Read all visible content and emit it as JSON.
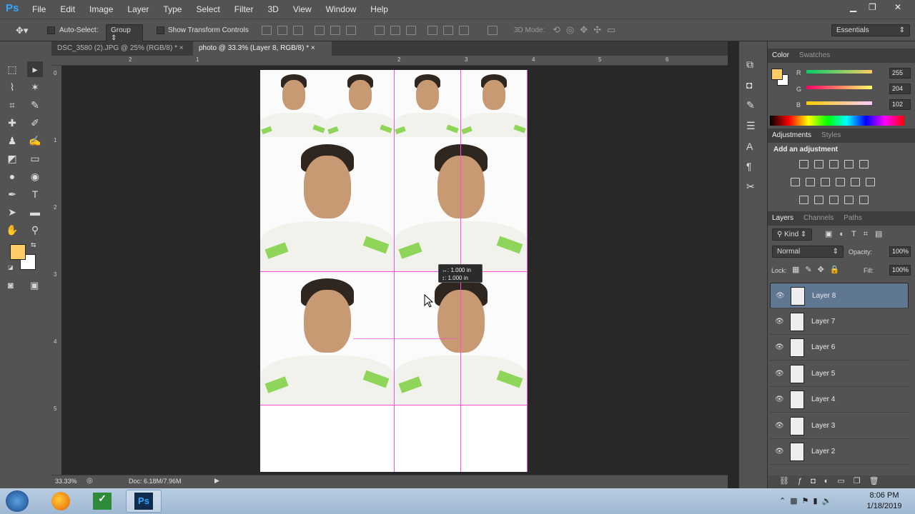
{
  "app": {
    "logo": "Ps"
  },
  "menu": [
    "File",
    "Edit",
    "Image",
    "Layer",
    "Type",
    "Select",
    "Filter",
    "3D",
    "View",
    "Window",
    "Help"
  ],
  "window_controls": {
    "minimize": "▁",
    "restore": "❐",
    "close": "✕"
  },
  "options": {
    "auto_select": "Auto-Select:",
    "auto_select_value": "Group",
    "show_transform": "Show Transform Controls",
    "mode_3d": "3D Mode:",
    "workspace": "Essentials"
  },
  "tabs": [
    {
      "label": "DSC_3580 (2).JPG @ 25% (RGB/8) *",
      "close": "×"
    },
    {
      "label": "photo @ 33.3% (Layer 8, RGB/8) *",
      "close": "×"
    }
  ],
  "ruler_h": [
    "2",
    "1",
    "2",
    "3",
    "4",
    "5",
    "6"
  ],
  "ruler_v": [
    "0",
    "1",
    "2",
    "3",
    "4",
    "5"
  ],
  "measure": {
    "w": "↔: 1.000 in",
    "h": "↕: 1.000 in"
  },
  "status": {
    "zoom": "33.33%",
    "doc": "Doc: 6.18M/7.96M"
  },
  "color_panel": {
    "tabs": [
      "Color",
      "Swatches"
    ],
    "r_label": "R",
    "g_label": "G",
    "b_label": "B",
    "r": "255",
    "g": "204",
    "b": "102",
    "foreground": "#ffcc66",
    "background": "#ffffff"
  },
  "adjustments": {
    "tabs": [
      "Adjustments",
      "Styles"
    ],
    "title": "Add an adjustment"
  },
  "layers_panel": {
    "tabs": [
      "Layers",
      "Channels",
      "Paths"
    ],
    "kind": "Kind",
    "blend": "Normal",
    "opacity_label": "Opacity:",
    "opacity": "100%",
    "lock_label": "Lock:",
    "fill_label": "Fill:",
    "fill": "100%",
    "layers": [
      "Layer 8",
      "Layer 7",
      "Layer 6",
      "Layer 5",
      "Layer 4",
      "Layer 3",
      "Layer 2"
    ]
  },
  "taskbar": {
    "time": "8:06 PM",
    "date": "1/18/2019"
  }
}
